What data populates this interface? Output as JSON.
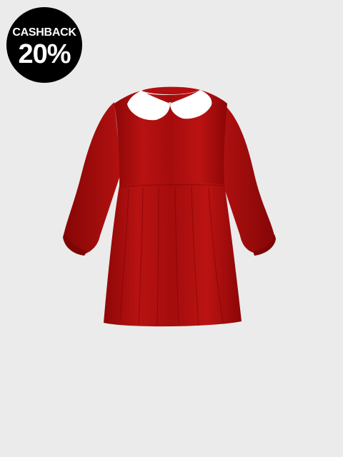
{
  "badge": {
    "label": "CASHBACK",
    "value": "20%",
    "background": "#000000",
    "text_color": "#ffffff"
  },
  "product": {
    "image": "red-velvet-dress-with-white-collar",
    "dress_color": "#b10f0f",
    "collar_color": "#ffffff"
  },
  "background_color": "#ebebeb"
}
